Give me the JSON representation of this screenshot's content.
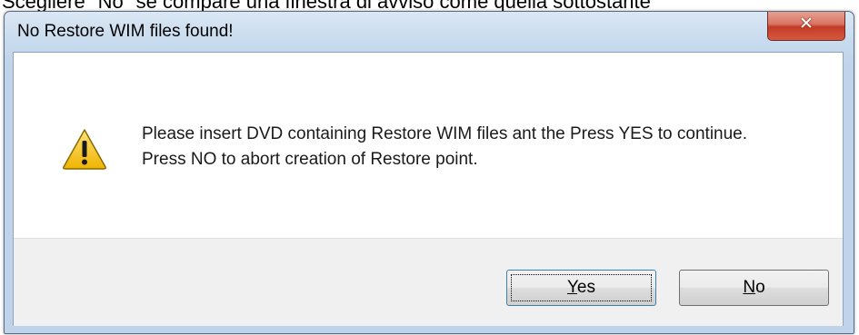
{
  "caption": "Scegliere \"No\" se compare una finestra di avviso come quella sottostante",
  "dialog": {
    "title": "No Restore WIM files found!",
    "close_glyph": "✕",
    "icon": "warning-icon",
    "message_line1": "Please insert DVD containing Restore WIM files ant the Press YES to continue.",
    "message_line2": "Press NO to abort creation of Restore point.",
    "buttons": {
      "yes_accel": "Y",
      "yes_rest": "es",
      "no_accel": "N",
      "no_rest": "o"
    }
  },
  "colors": {
    "close_button": "#c43b26",
    "warning_fill": "#f5c518",
    "focus_border": "#3c7fb1"
  }
}
